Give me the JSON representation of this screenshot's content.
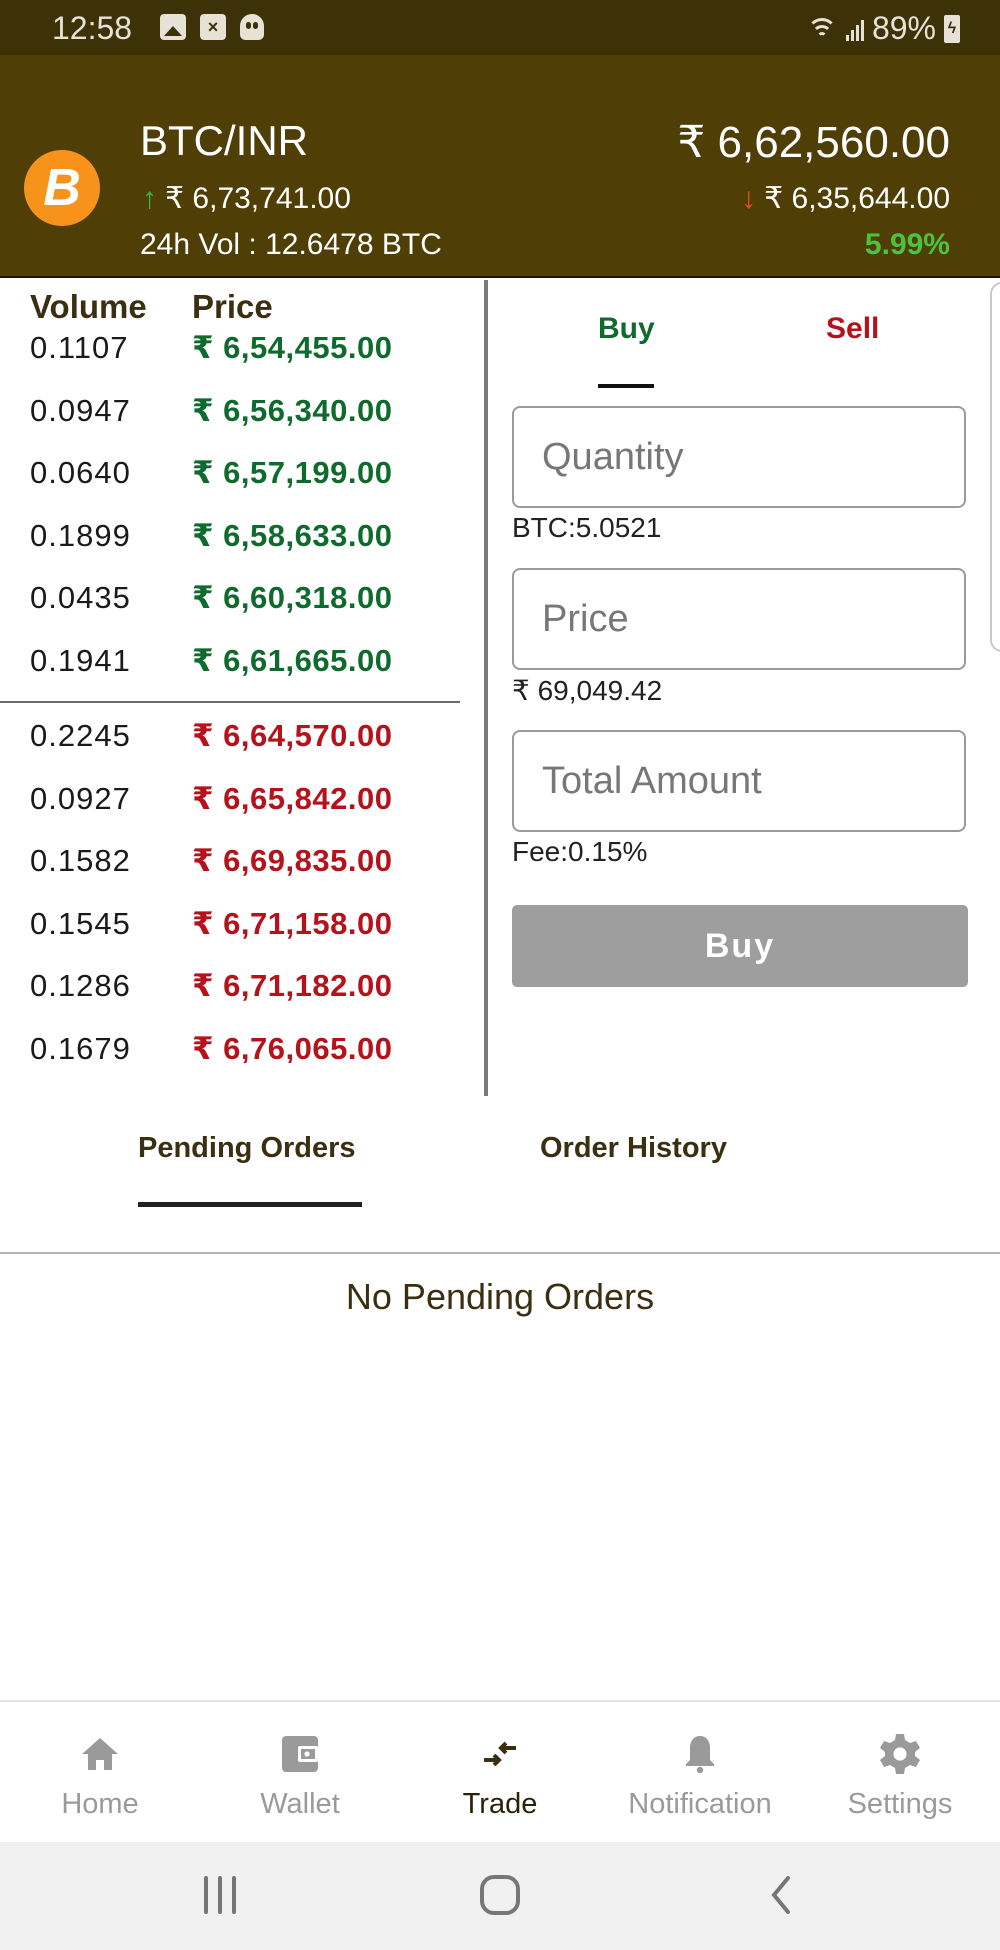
{
  "status_bar": {
    "time": "12:58",
    "battery": "89%",
    "icons": [
      "image-icon",
      "sim-error-icon",
      "ghost-app-icon",
      "wifi-icon",
      "signal-icon",
      "battery-charging-icon"
    ]
  },
  "header": {
    "pair": "BTC/INR",
    "coin_icon": "bitcoin-icon",
    "high_24h": "₹ 6,73,741.00",
    "low_24h": "₹ 6,35,644.00",
    "volume_24h": "24h Vol : 12.6478 BTC",
    "last_price": "₹ 6,62,560.00",
    "change_percent": "5.99%",
    "colors": {
      "background": "#4f3f06",
      "up": "#3cb93c",
      "down": "#e74c2a",
      "change": "#4cc23d"
    }
  },
  "orderbook": {
    "headers": {
      "volume": "Volume",
      "price": "Price"
    },
    "bids": [
      {
        "volume": "0.1107",
        "price": "₹ 6,54,455.00"
      },
      {
        "volume": "0.0947",
        "price": "₹ 6,56,340.00"
      },
      {
        "volume": "0.0640",
        "price": "₹ 6,57,199.00"
      },
      {
        "volume": "0.1899",
        "price": "₹ 6,58,633.00"
      },
      {
        "volume": "0.0435",
        "price": "₹ 6,60,318.00"
      },
      {
        "volume": "0.1941",
        "price": "₹ 6,61,665.00"
      }
    ],
    "asks": [
      {
        "volume": "0.2245",
        "price": "₹ 6,64,570.00"
      },
      {
        "volume": "0.0927",
        "price": "₹ 6,65,842.00"
      },
      {
        "volume": "0.1582",
        "price": "₹ 6,69,835.00"
      },
      {
        "volume": "0.1545",
        "price": "₹ 6,71,158.00"
      },
      {
        "volume": "0.1286",
        "price": "₹ 6,71,182.00"
      },
      {
        "volume": "0.1679",
        "price": "₹ 6,76,065.00"
      }
    ],
    "colors": {
      "bid": "#0f6a2e",
      "ask": "#b5121b"
    }
  },
  "trade_panel": {
    "tabs": {
      "buy": "Buy",
      "sell": "Sell",
      "active": "buy"
    },
    "quantity_placeholder": "Quantity",
    "quantity_value": "",
    "btc_balance": "BTC:5.0521",
    "price_placeholder": "Price",
    "price_value": "",
    "inr_balance": "₹ 69,049.42",
    "total_placeholder": "Total Amount",
    "total_value": "",
    "fee": "Fee:0.15%",
    "submit_label": "Buy"
  },
  "orders": {
    "tabs": {
      "pending": "Pending Orders",
      "history": "Order History",
      "active": "pending"
    },
    "empty_message": "No Pending Orders"
  },
  "bottom_nav": {
    "items": [
      {
        "label": "Home",
        "icon": "home-icon"
      },
      {
        "label": "Wallet",
        "icon": "wallet-icon"
      },
      {
        "label": "Trade",
        "icon": "trade-icon",
        "active": true
      },
      {
        "label": "Notification",
        "icon": "bell-icon"
      },
      {
        "label": "Settings",
        "icon": "gear-icon"
      }
    ]
  },
  "system_nav": {
    "buttons": [
      "recent-apps-icon",
      "home-circle-icon",
      "back-icon"
    ]
  }
}
